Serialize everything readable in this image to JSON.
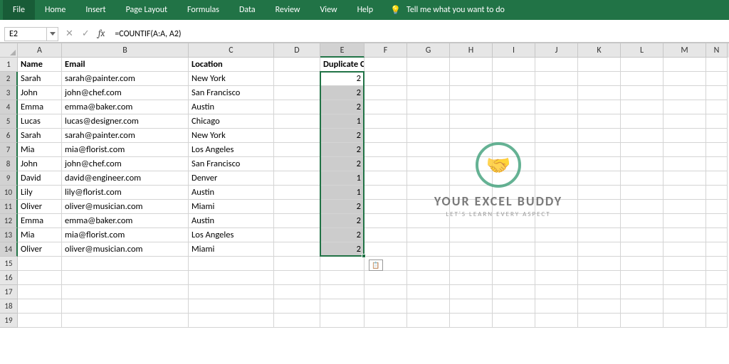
{
  "ribbon": {
    "tabs": [
      "File",
      "Home",
      "Insert",
      "Page Layout",
      "Formulas",
      "Data",
      "Review",
      "View",
      "Help"
    ],
    "tellme": "Tell me what you want to do"
  },
  "namebox": "E2",
  "formula": "=COUNTIF(A:A, A2)",
  "columns": [
    "A",
    "B",
    "C",
    "D",
    "E",
    "F",
    "G",
    "H",
    "I",
    "J",
    "K",
    "L",
    "M",
    "N"
  ],
  "header_row": {
    "A": "Name",
    "B": "Email",
    "C": "Location",
    "D": "",
    "E": "Duplicate Check"
  },
  "rows": [
    {
      "A": "Sarah",
      "B": "sarah@painter.com",
      "C": "New York",
      "E": "2"
    },
    {
      "A": "John",
      "B": "john@chef.com",
      "C": "San Francisco",
      "E": "2"
    },
    {
      "A": "Emma",
      "B": "emma@baker.com",
      "C": "Austin",
      "E": "2"
    },
    {
      "A": "Lucas",
      "B": "lucas@designer.com",
      "C": "Chicago",
      "E": "1"
    },
    {
      "A": "Sarah",
      "B": "sarah@painter.com",
      "C": "New York",
      "E": "2"
    },
    {
      "A": "Mia",
      "B": "mia@florist.com",
      "C": "Los Angeles",
      "E": "2"
    },
    {
      "A": "John",
      "B": "john@chef.com",
      "C": "San Francisco",
      "E": "2"
    },
    {
      "A": "David",
      "B": "david@engineer.com",
      "C": "Denver",
      "E": "1"
    },
    {
      "A": "Lily",
      "B": "lily@florist.com",
      "C": "Austin",
      "E": "1"
    },
    {
      "A": "Oliver",
      "B": "oliver@musician.com",
      "C": "Miami",
      "E": "2"
    },
    {
      "A": "Emma",
      "B": "emma@baker.com",
      "C": "Austin",
      "E": "2"
    },
    {
      "A": "Mia",
      "B": "mia@florist.com",
      "C": "Los Angeles",
      "E": "2"
    },
    {
      "A": "Oliver",
      "B": "oliver@musician.com",
      "C": "Miami",
      "E": "2"
    }
  ],
  "total_visible_rows": 19,
  "watermark": {
    "line1": "YOUR EXCEL BUDDY",
    "line2": "LET'S LEARN EVERY ASPECT"
  },
  "selected_col": "E",
  "selected_rows": [
    2,
    14
  ]
}
